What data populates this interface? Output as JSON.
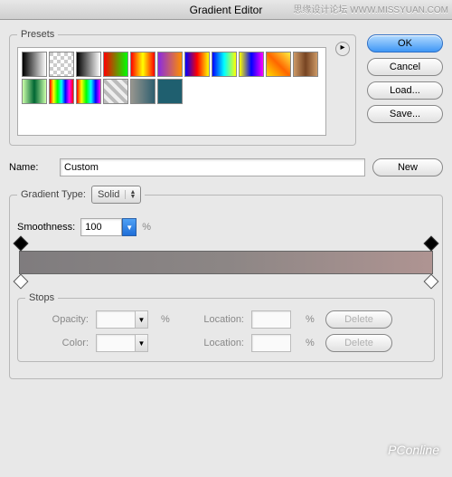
{
  "title": "Gradient Editor",
  "watermark_top": "思缘设计论坛  WWW.MISSYUAN.COM",
  "watermark_bottom": "PConline",
  "buttons": {
    "ok": "OK",
    "cancel": "Cancel",
    "load": "Load...",
    "save": "Save...",
    "new": "New",
    "delete1": "Delete",
    "delete2": "Delete"
  },
  "presets": {
    "legend": "Presets",
    "swatches": [
      "linear-gradient(90deg,#000,#fff)",
      "repeating-conic-gradient(#fff 0 25%,#ccc 0 50%) 0 0/8px 8px",
      "linear-gradient(90deg,#000,#fff)",
      "linear-gradient(90deg,#f00,#0f0)",
      "linear-gradient(90deg,#f00,#ff0,#f00)",
      "linear-gradient(90deg,#8a2be2,#ff8c00)",
      "linear-gradient(90deg,#00f,#f00,#ff0)",
      "linear-gradient(90deg,#00f,#0ff,#ff0)",
      "linear-gradient(90deg,#ff0,#00f,#f0f)",
      "linear-gradient(45deg,#ffdd00,#ff6600,#ffee40)",
      "linear-gradient(90deg,#c96,#742,#c96)",
      "linear-gradient(90deg,#cfa,#063,#cfa)",
      "linear-gradient(90deg,#f00,#ff0,#0f0,#0ff,#00f,#f0f,#f00)",
      "linear-gradient(90deg,#f00,#ff0,#0f0,#0ff,#00f,#f0f)",
      "repeating-linear-gradient(45deg,#bbb 0 4px,#eee 4px 8px)",
      "linear-gradient(90deg,#97968f,#2f5f6f)",
      "#1f5f6f"
    ]
  },
  "name": {
    "label": "Name:",
    "value": "Custom"
  },
  "gradient_type": {
    "legend": "Gradient Type:",
    "value": "Solid"
  },
  "smoothness": {
    "label": "Smoothness:",
    "value": "100",
    "unit": "%"
  },
  "stops": {
    "legend": "Stops",
    "opacity_label": "Opacity:",
    "color_label": "Color:",
    "location_label": "Location:",
    "unit": "%"
  },
  "gradient_data": {
    "type": "linear",
    "color_stops": [
      {
        "position": 0,
        "color": "#7f7c7e"
      },
      {
        "position": 100,
        "color": "#af9492"
      }
    ],
    "opacity_stops": [
      {
        "position": 0,
        "opacity": 100
      },
      {
        "position": 100,
        "opacity": 100
      }
    ]
  }
}
